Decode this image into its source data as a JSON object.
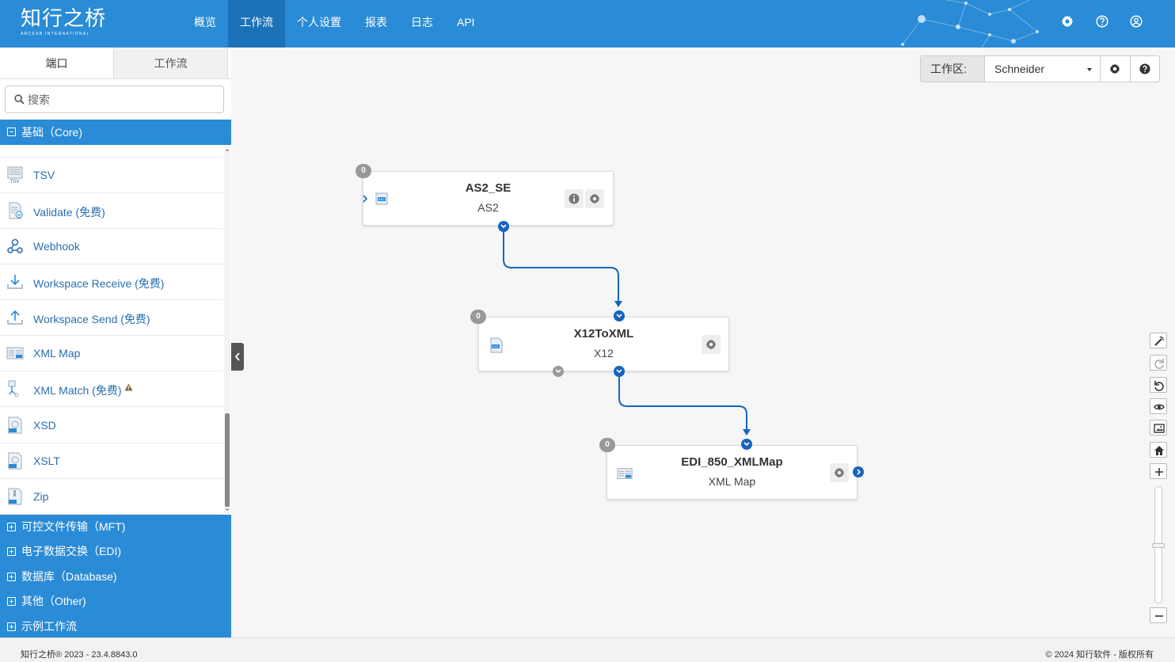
{
  "app": {
    "logo_text": "知行之桥",
    "logo_sub": "ARCESB INTERNATIONAL"
  },
  "nav": [
    "概览",
    "工作流",
    "个人设置",
    "报表",
    "日志",
    "API"
  ],
  "sidebar": {
    "tabs": [
      "端口",
      "工作流"
    ],
    "search_placeholder": "搜索",
    "core_group": "基础（Core)",
    "items": [
      {
        "label": "TSV",
        "icon": "tsv-icon"
      },
      {
        "label": "Validate (免费)",
        "icon": "validate-icon"
      },
      {
        "label": "Webhook",
        "icon": "webhook-icon"
      },
      {
        "label": "Workspace Receive (免费)",
        "icon": "workspace-receive-icon"
      },
      {
        "label": "Workspace Send (免费)",
        "icon": "workspace-send-icon"
      },
      {
        "label": "XML Map",
        "icon": "xml-map-icon"
      },
      {
        "label": "XML Match (免费)",
        "icon": "xml-match-icon"
      },
      {
        "label": "XSD",
        "icon": "xsd-icon"
      },
      {
        "label": "XSLT",
        "icon": "xslt-icon"
      },
      {
        "label": "Zip",
        "icon": "zip-icon"
      }
    ],
    "groups": [
      "可控文件传输（MFT)",
      "电子数据交换（EDI)",
      "数据库（Database)",
      "其他（Other)",
      "示例工作流"
    ]
  },
  "workspace": {
    "label": "工作区:",
    "selected": "Schneider"
  },
  "flow": {
    "nodes": [
      {
        "title": "AS2_SE",
        "subtitle": "AS2",
        "badge": "0"
      },
      {
        "title": "X12ToXML",
        "subtitle": "X12",
        "badge": "0"
      },
      {
        "title": "EDI_850_XMLMap",
        "subtitle": "XML Map",
        "badge": "0"
      }
    ]
  },
  "colors": {
    "primary": "#2a8bd6",
    "nav_active": "#1b72b8",
    "edge": "#1565c0",
    "link_text": "#2a6fb0"
  },
  "footer": {
    "left": "知行之桥® 2023 - 23.4.8843.0",
    "right": "© 2024 知行软件 - 版权所有"
  }
}
